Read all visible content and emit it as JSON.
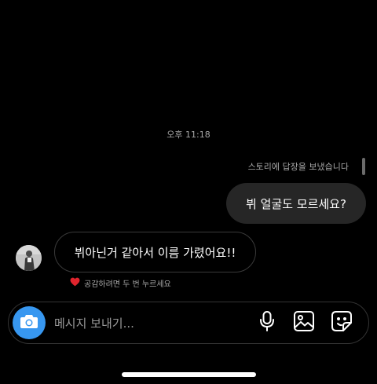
{
  "thread": {
    "timestamp": "오후 11:18",
    "story_reply_note": "스토리에 답장을 보냈습니다",
    "messages": [
      {
        "direction": "sent",
        "text": "뷔 얼굴도 모르세요?"
      },
      {
        "direction": "received",
        "text": "뷔아닌거 같아서 이름 가렸어요!!"
      }
    ],
    "reaction_hint": "공감하려면 두 번 누르세요",
    "reaction_icon": "heart-icon"
  },
  "composer": {
    "placeholder": "메시지 보내기...",
    "camera_icon": "camera-icon",
    "mic_icon": "microphone-icon",
    "gallery_icon": "image-icon",
    "sticker_icon": "sticker-icon"
  },
  "colors": {
    "background": "#000000",
    "sent_bubble": "#262626",
    "received_bubble_border": "#3a3a3a",
    "muted_text": "#a8a8a8",
    "camera_button": "#3797f0",
    "heart": "#e0242d"
  }
}
